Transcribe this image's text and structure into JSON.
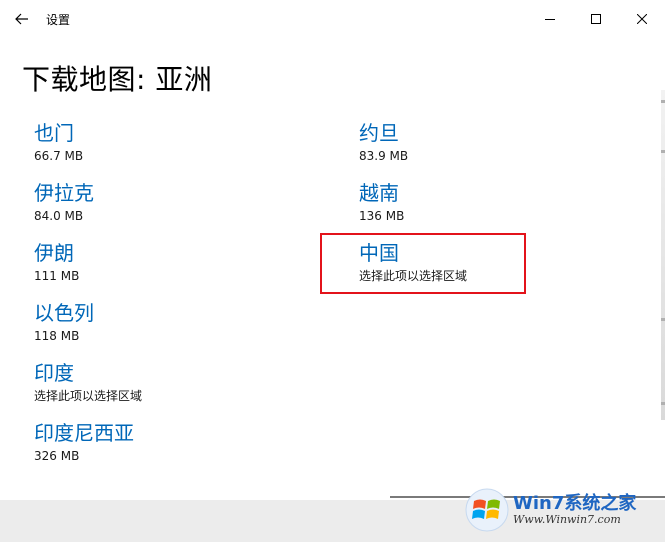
{
  "window": {
    "title": "设置",
    "controls": [
      "minimize",
      "maximize",
      "close"
    ]
  },
  "page": {
    "title": "下载地图: 亚洲"
  },
  "regions": [
    {
      "name": "也门",
      "info": "66.7 MB"
    },
    {
      "name": "伊拉克",
      "info": "84.0 MB"
    },
    {
      "name": "伊朗",
      "info": "111 MB"
    },
    {
      "name": "以色列",
      "info": "118 MB"
    },
    {
      "name": "印度",
      "info": "选择此项以选择区域"
    },
    {
      "name": "印度尼西亚",
      "info": "326 MB"
    },
    {
      "name": "约旦",
      "info": "83.9 MB"
    },
    {
      "name": "越南",
      "info": "136 MB"
    },
    {
      "name": "中国",
      "info": "选择此项以选择区域"
    }
  ],
  "watermark": {
    "line1": "Win7系统之家",
    "line2": "Www.Winwin7.com"
  },
  "colors": {
    "link": "#0067b8",
    "highlight": "#e3131b"
  }
}
